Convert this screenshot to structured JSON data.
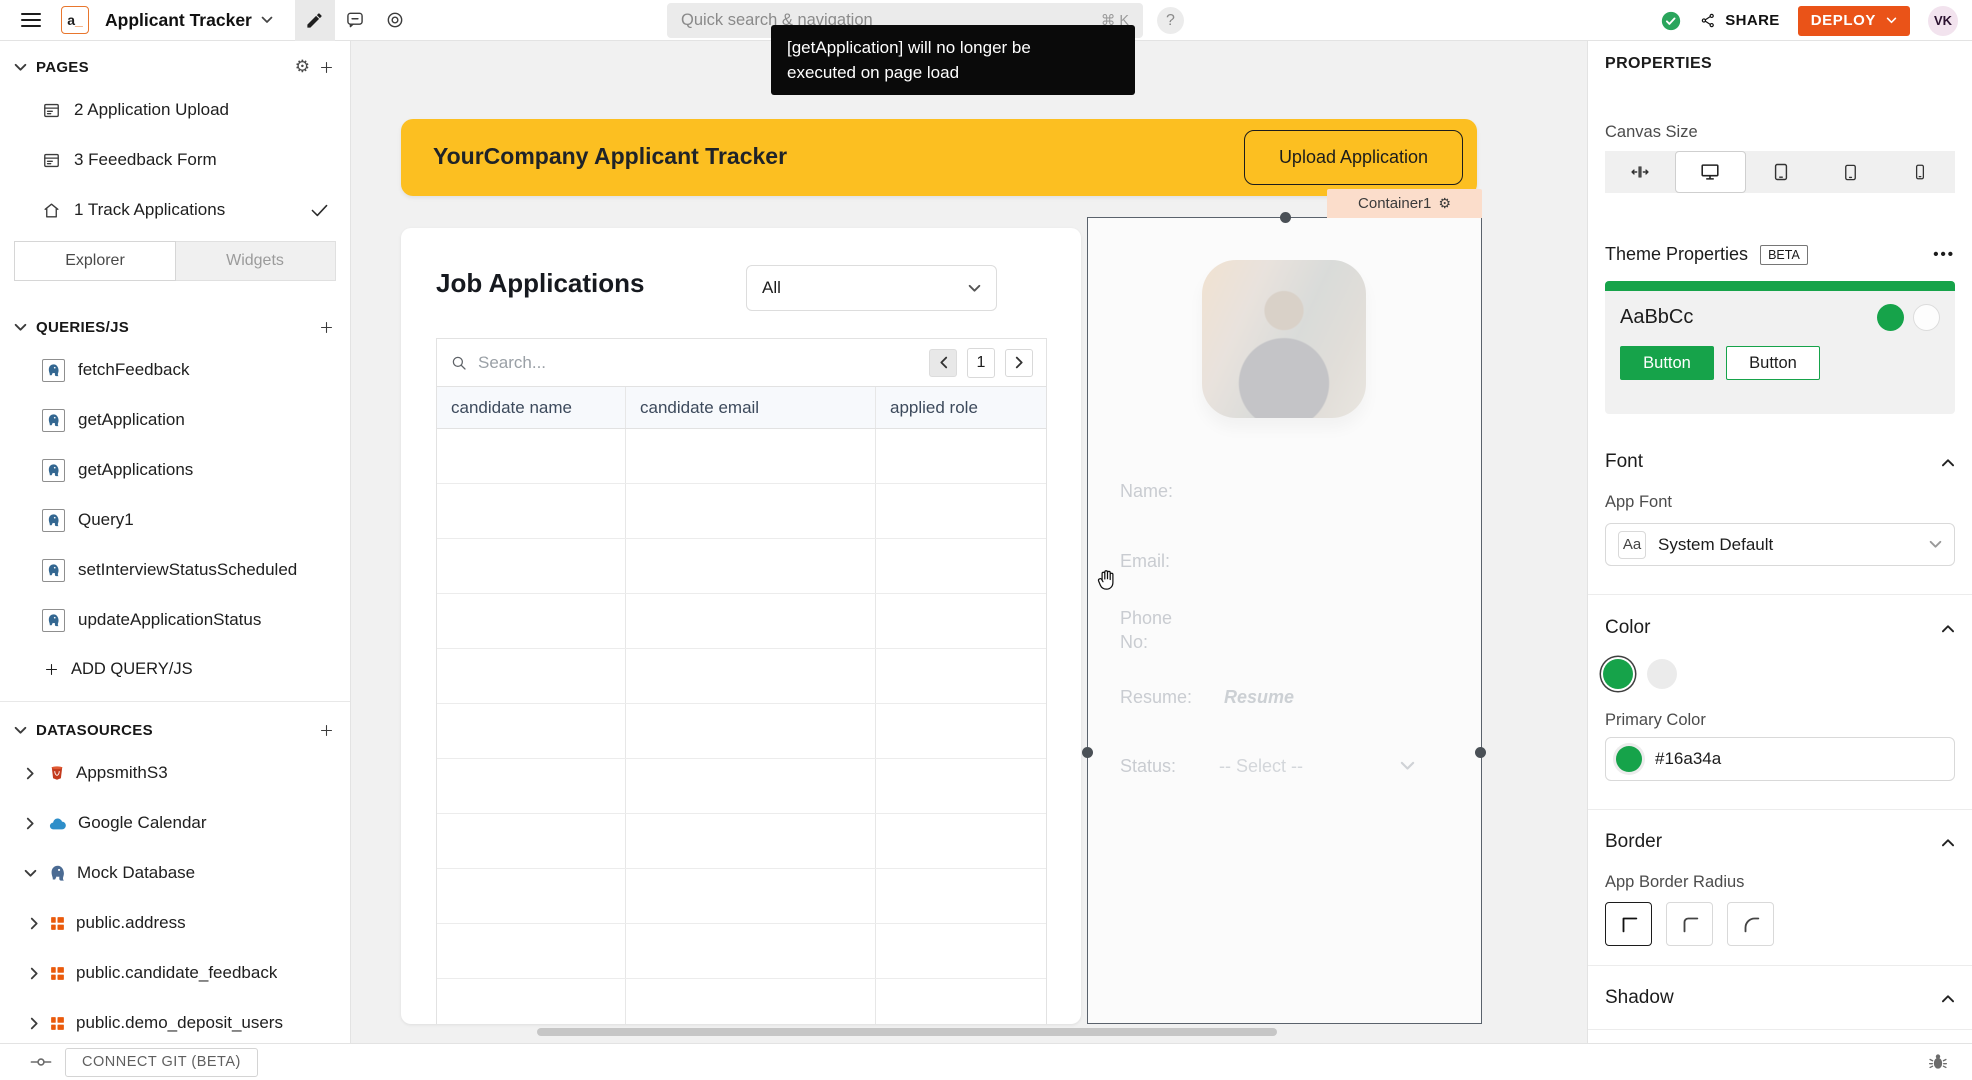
{
  "colors": {
    "primary": "#16a34a",
    "deploy": "#ea5318",
    "yellow": "#fcbf21"
  },
  "topbar": {
    "app_title": "Applicant Tracker",
    "quick_search": "Quick search & navigation",
    "shortcut": "⌘ K",
    "help": "?",
    "share": "SHARE",
    "deploy": "DEPLOY",
    "avatar": "VK"
  },
  "toast": {
    "line1": "[getApplication] will no longer be",
    "line2": "executed on page load"
  },
  "sidebar": {
    "pages_header": "PAGES",
    "pages": [
      "2 Application Upload",
      "3 Feeedback Form",
      "1 Track Applications"
    ],
    "tabs": {
      "explorer": "Explorer",
      "widgets": "Widgets"
    },
    "queries_header": "QUERIES/JS",
    "queries": [
      "fetchFeedback",
      "getApplication",
      "getApplications",
      "Query1",
      "setInterviewStatusScheduled",
      "updateApplicationStatus"
    ],
    "add_query": "ADD QUERY/JS",
    "datasources_header": "DATASOURCES",
    "datasources": [
      "AppsmithS3",
      "Google Calendar",
      "Mock Database"
    ],
    "tables": [
      "public.address",
      "public.candidate_feedback",
      "public.demo_deposit_users"
    ],
    "connect_git": "CONNECT GIT (BETA)"
  },
  "canvas": {
    "app_header": {
      "title": "YourCompany Applicant Tracker",
      "upload_button": "Upload Application"
    },
    "container_tag": "Container1",
    "table": {
      "title": "Job Applications",
      "filter": "All",
      "search_placeholder": "Search...",
      "page": "1",
      "columns": [
        "candidate name",
        "candidate email",
        "applied role"
      ],
      "empty_row_count": 11
    },
    "detail": {
      "name_label": "Name:",
      "email_label": "Email:",
      "phone_label": "Phone No:",
      "resume_label": "Resume:",
      "resume_value": "Resume",
      "status_label": "Status:",
      "status_value": "-- Select --"
    }
  },
  "properties": {
    "title": "PROPERTIES",
    "canvas_size": "Canvas Size",
    "theme_properties": "Theme Properties",
    "beta": "BETA",
    "sample": "AaBbCc",
    "button_primary": "Button",
    "button_secondary": "Button",
    "font": "Font",
    "app_font": "App Font",
    "font_badge": "Aa",
    "font_value": "System Default",
    "color": "Color",
    "primary_color": "Primary Color",
    "primary_value": "#16a34a",
    "border": "Border",
    "radius_label": "App Border Radius",
    "shadow": "Shadow"
  }
}
